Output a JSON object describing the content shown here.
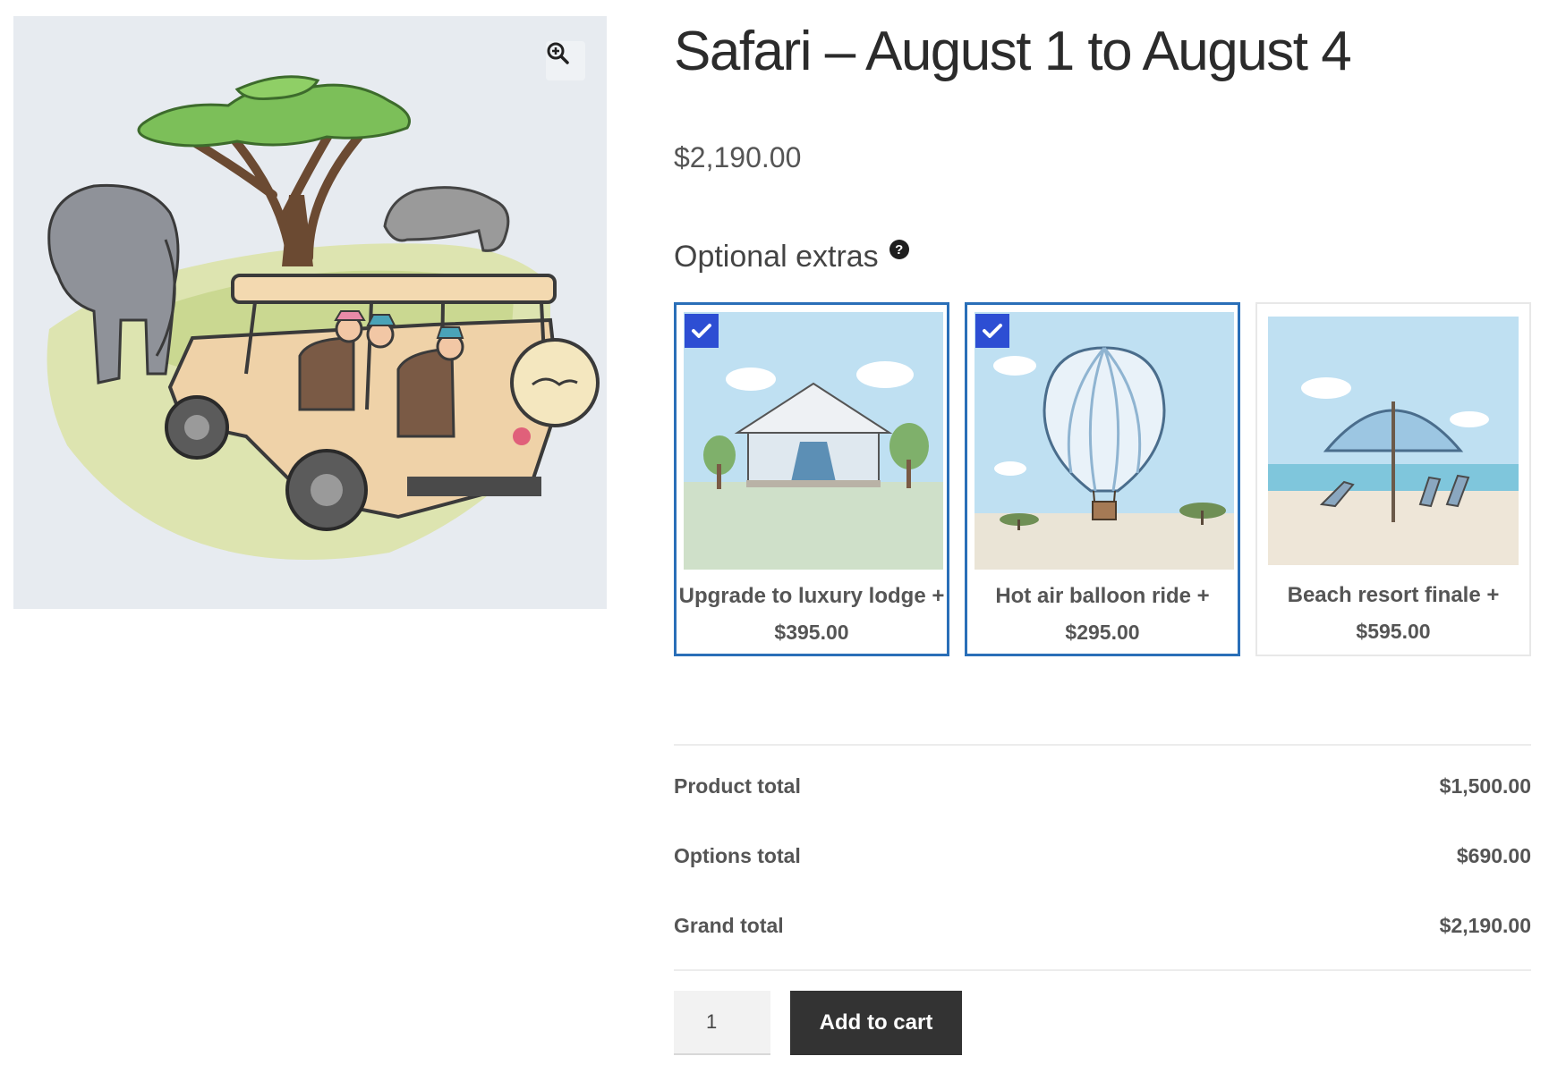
{
  "gallery": {
    "image_alt": "Safari illustration with elephant, rhino, acacia tree and safari jeep",
    "zoom_icon": "zoom-in-icon"
  },
  "product": {
    "title": "Safari – August 1 to August 4",
    "price": "$2,190.00"
  },
  "extras": {
    "heading": "Optional extras",
    "help_icon": "?",
    "items": [
      {
        "name": "Upgrade to luxury lodge +",
        "price": "$395.00",
        "selected": true,
        "icon": "lodge-image"
      },
      {
        "name": "Hot air balloon ride +",
        "price": "$295.00",
        "selected": true,
        "icon": "balloon-image"
      },
      {
        "name": "Beach resort finale +",
        "price": "$595.00",
        "selected": false,
        "icon": "beach-image"
      }
    ]
  },
  "totals": {
    "rows": [
      {
        "label": "Product total",
        "value": "$1,500.00"
      },
      {
        "label": "Options total",
        "value": "$690.00"
      },
      {
        "label": "Grand total",
        "value": "$2,190.00"
      }
    ]
  },
  "cart": {
    "quantity": "1",
    "button_label": "Add to cart"
  },
  "colors": {
    "selected_border": "#2a6fb8",
    "check_bg": "#2d4ed3",
    "button_bg": "#333333"
  }
}
